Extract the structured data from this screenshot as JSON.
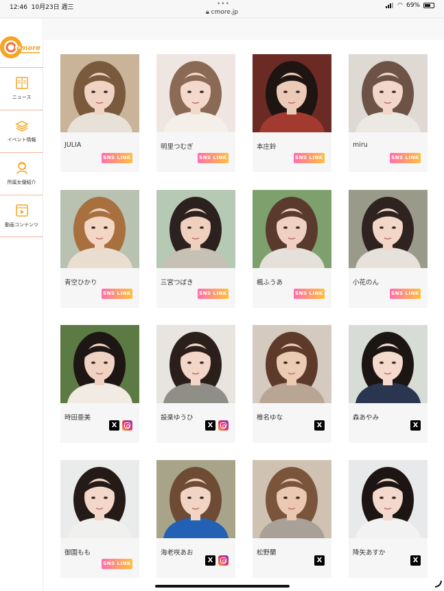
{
  "status_bar": {
    "time": "12:46",
    "date": "10月23日 週三",
    "dots": "•••",
    "url": "cmore.jp",
    "battery": "69%",
    "battery_level": 0.69
  },
  "brand": {
    "logo_text": "cmore",
    "accent": "#f5a623",
    "nav_border": "#f4b39a"
  },
  "sidebar": {
    "items": [
      {
        "label": "ニュース",
        "icon": "news-icon"
      },
      {
        "label": "イベント情報",
        "icon": "event-icon"
      },
      {
        "label": "所属女優紹介",
        "icon": "actress-icon"
      },
      {
        "label": "動画コンテンツ",
        "icon": "video-icon"
      }
    ]
  },
  "cards": [
    {
      "name": "JULIA",
      "links": "sns-link",
      "sns_label": "SNS LINK"
    },
    {
      "name": "明里つむぎ",
      "links": "sns-link",
      "sns_label": "SNS LINK"
    },
    {
      "name": "本庄鈴",
      "links": "sns-link",
      "sns_label": "SNS LINK"
    },
    {
      "name": "miru",
      "links": "sns-link",
      "sns_label": "SNS LINK"
    },
    {
      "name": "青空ひかり",
      "links": "sns-link",
      "sns_label": "SNS LINK"
    },
    {
      "name": "三宮つばき",
      "links": "sns-link",
      "sns_label": "SNS LINK"
    },
    {
      "name": "楓ふうあ",
      "links": "sns-link",
      "sns_label": "SNS LINK"
    },
    {
      "name": "小花のん",
      "links": "sns-link",
      "sns_label": "SNS LINK"
    },
    {
      "name": "時田亜美",
      "links": "x-instagram",
      "x_label": "X"
    },
    {
      "name": "設楽ゆうひ",
      "links": "x-instagram",
      "x_label": "X"
    },
    {
      "name": "椎名ゆな",
      "links": "x-only",
      "x_label": "X"
    },
    {
      "name": "森あやみ",
      "links": "x-only",
      "x_label": "X"
    },
    {
      "name": "御園もも",
      "links": "sns-link",
      "sns_label": "SNS LINK"
    },
    {
      "name": "海老咲あお",
      "links": "x-instagram",
      "x_label": "X"
    },
    {
      "name": "松野蘭",
      "links": "x-only",
      "x_label": "X"
    },
    {
      "name": "降矢あすか",
      "links": "x-only",
      "x_label": "X"
    }
  ]
}
